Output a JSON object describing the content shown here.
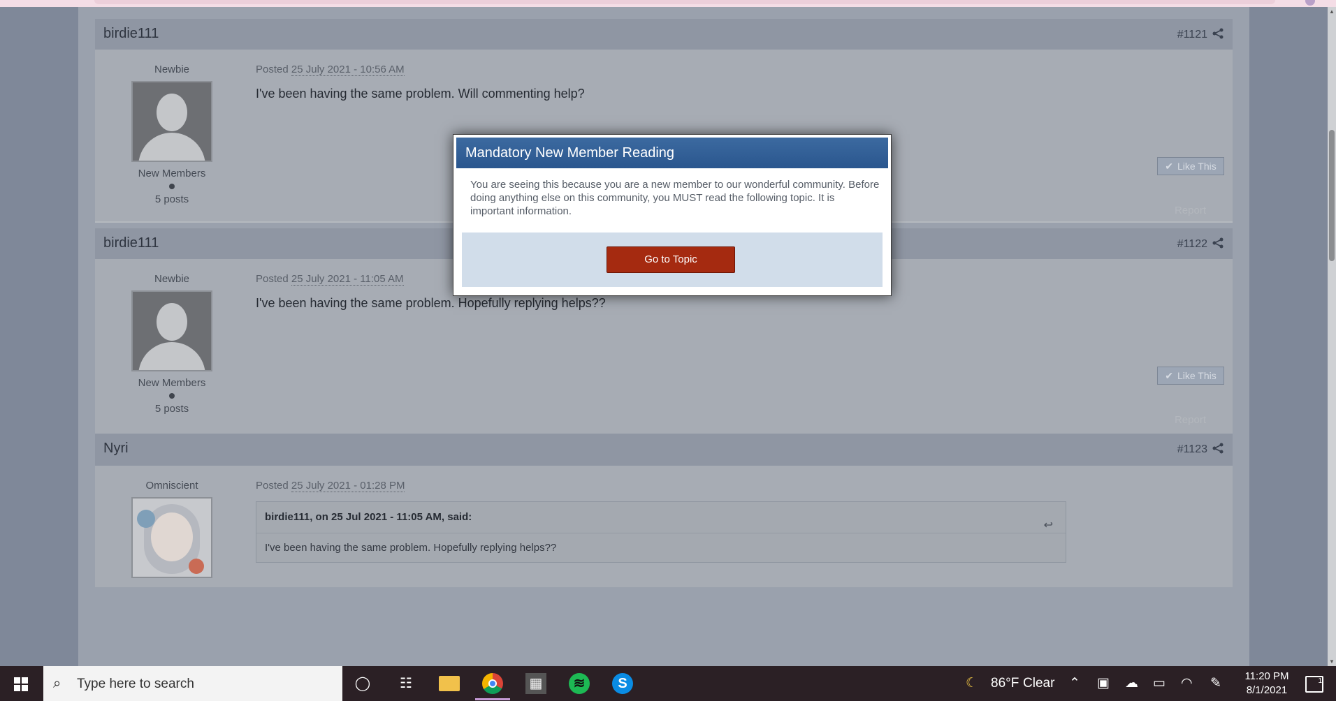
{
  "posts": [
    {
      "author": "birdie111",
      "number": "#1121",
      "rank": "Newbie",
      "group": "New Members",
      "post_count": "5 posts",
      "posted_prefix": "Posted",
      "posted_date": "25 July 2021 - 10:56 AM",
      "message": "I've been having the same problem. Will commenting help?",
      "like_label": "Like This",
      "report_label": "Report"
    },
    {
      "author": "birdie111",
      "number": "#1122",
      "rank": "Newbie",
      "group": "New Members",
      "post_count": "5 posts",
      "posted_prefix": "Posted",
      "posted_date": "25 July 2021 - 11:05 AM",
      "message": "I've been having the same problem. Hopefully replying helps??",
      "like_label": "Like This",
      "report_label": "Report"
    },
    {
      "author": "Nyri",
      "number": "#1123",
      "rank": "Omniscient",
      "posted_prefix": "Posted",
      "posted_date": "25 July 2021 - 01:28 PM",
      "quote_header": "birdie111, on 25 Jul 2021 - 11:05 AM, said:",
      "quote_text": "I've been having the same problem. Hopefully replying helps??"
    }
  ],
  "modal": {
    "title": "Mandatory New Member Reading",
    "text": "You are seeing this because you are a new member to our wonderful community. Before doing anything else on this community, you MUST read the following topic. It is important information.",
    "button": "Go to Topic"
  },
  "taskbar": {
    "search_placeholder": "Type here to search",
    "weather_temp": "86°F",
    "weather_cond": "Clear",
    "time": "11:20 PM",
    "date": "8/1/2021",
    "notif_count": "1"
  },
  "colors": {
    "modal_title_bg": "#2a568e",
    "go_button_bg": "#a52a10",
    "taskbar_bg": "#2b2025"
  }
}
